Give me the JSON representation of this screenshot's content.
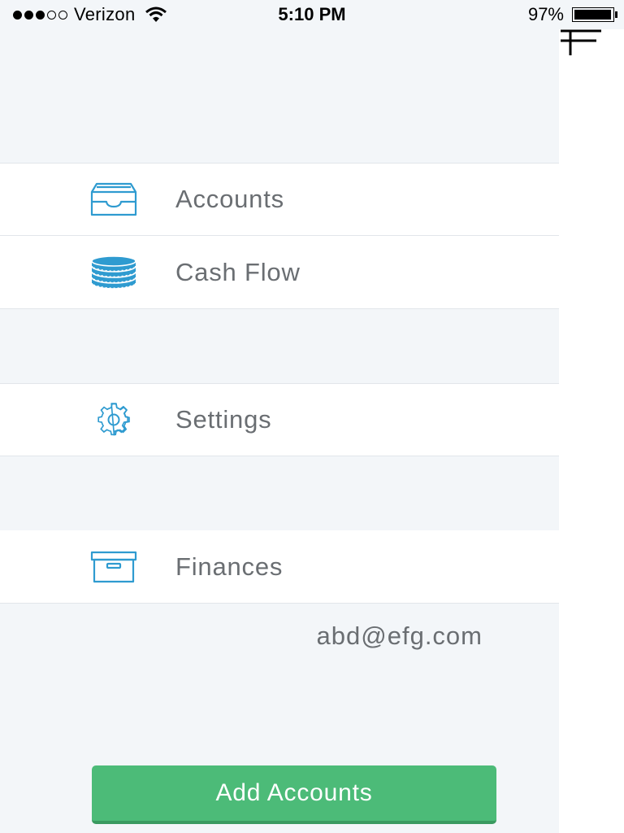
{
  "status_bar": {
    "signal_filled": 3,
    "signal_total": 5,
    "carrier": "Verizon",
    "time": "5:10 PM",
    "battery_percent": "97%",
    "battery_level": 0.97
  },
  "menu": {
    "items": [
      {
        "label": "Accounts",
        "icon": "inbox-tray-icon"
      },
      {
        "label": "Cash Flow",
        "icon": "coins-stack-icon"
      },
      {
        "label": "Settings",
        "icon": "gear-icon"
      },
      {
        "label": "Finances",
        "icon": "archive-box-icon"
      }
    ]
  },
  "account": {
    "email": "abd@efg.com"
  },
  "actions": {
    "add_accounts_label": "Add Accounts"
  },
  "colors": {
    "drawer_background": "#f3f6f9",
    "icon_accent": "#2f9bd0",
    "label_text": "#6a6e72",
    "button_green": "#4cbb78"
  }
}
